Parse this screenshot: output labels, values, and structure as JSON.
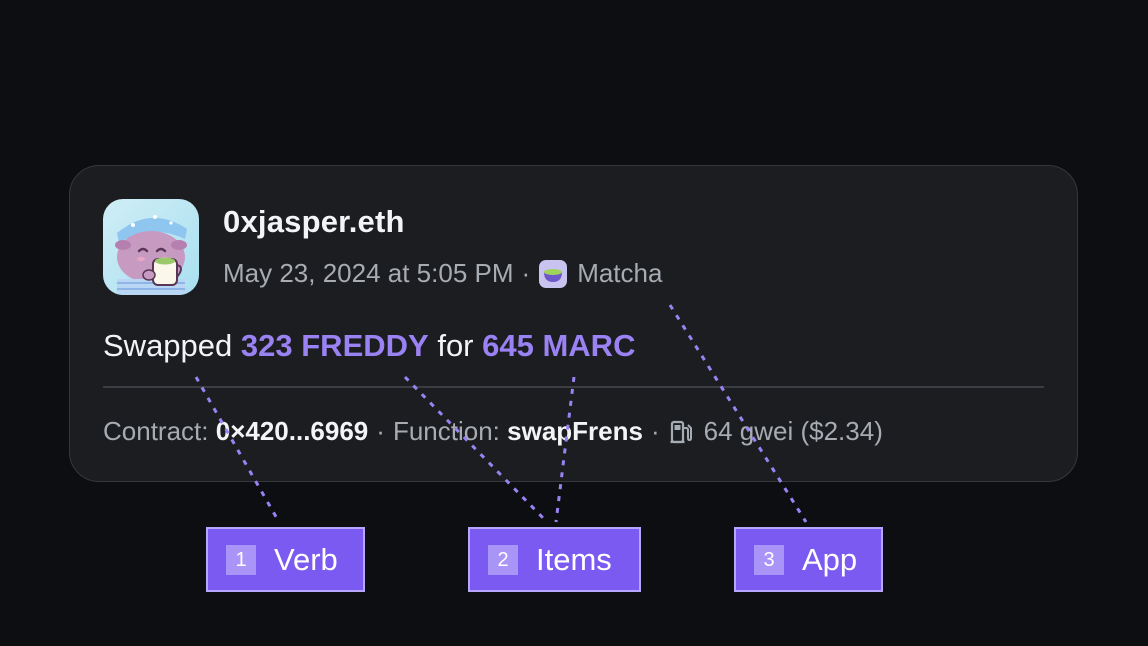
{
  "card": {
    "avatar_icon": "frog-mascot-avatar",
    "user_name": "0xjasper.eth",
    "date": "May 23, 2024 at 5:05 PM",
    "separator": "·",
    "app_icon": "matcha-icon",
    "app_name": "Matcha",
    "action": {
      "verb": "Swapped",
      "amount_in": "323 FREDDY",
      "connector": "for",
      "amount_out": "645 MARC"
    },
    "details": {
      "contract_label": "Contract:",
      "contract_value": "0×420...6969",
      "function_label": "Function:",
      "function_value": "swapFrens",
      "gas_icon": "gas-pump-icon",
      "gas_value": "64 gwei ($2.34)"
    }
  },
  "tags": [
    {
      "number": "1",
      "label": "Verb"
    },
    {
      "number": "2",
      "label": "Items"
    },
    {
      "number": "3",
      "label": "App"
    }
  ],
  "colors": {
    "background": "#0c0e11",
    "card": "#1b1d20",
    "accent": "#9b82f3",
    "tag": "#7b5af1"
  }
}
